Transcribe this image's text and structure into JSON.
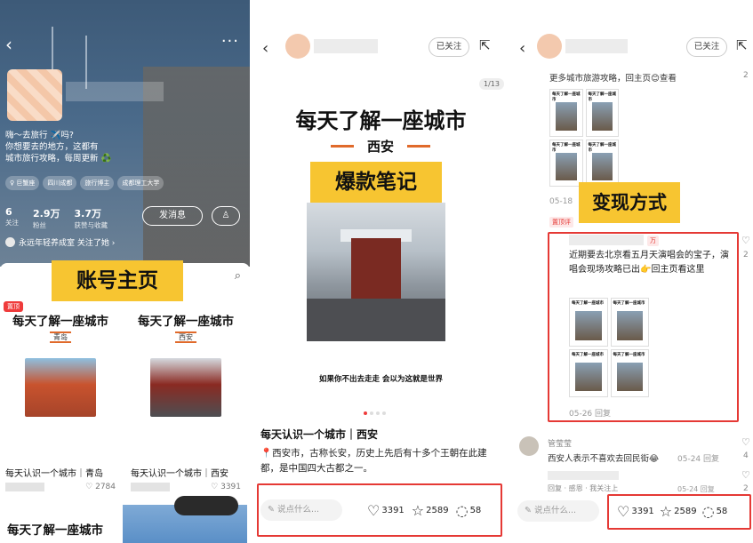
{
  "panel1": {
    "overlay_label": "账号主页",
    "bio": [
      "嗨～去旅行 ✈️吗?",
      "你想要去的地方，这都有",
      "城市旅行攻略，每周更新 ♻️"
    ],
    "tags": [
      "♀ 巨蟹座",
      "四川成都",
      "旅行博主",
      "成都理工大学"
    ],
    "stats": [
      {
        "value": "6",
        "label": "关注"
      },
      {
        "value": "2.9万",
        "label": "粉丝"
      },
      {
        "value": "3.7万",
        "label": "获赞与收藏"
      }
    ],
    "message_button": "发消息",
    "followed_by": "永远年轻养成室 关注了她 ›",
    "pin_badge": "置顶",
    "cards": [
      {
        "title": "每天了解一座城市",
        "city": "青岛",
        "name": "每天认识一个城市｜青岛",
        "likes": "2784"
      },
      {
        "title": "每天了解一座城市",
        "city": "西安",
        "name": "每天认识一个城市｜西安",
        "likes": "3391"
      }
    ],
    "bottom_title": "每天了解一座城市"
  },
  "panel2": {
    "follow_label": "已关注",
    "page_indicator": "1/13",
    "title": "每天了解一座城市",
    "city": "西安",
    "overlay_label": "爆款笔记",
    "quote": "如果你不出去走走 会以为这就是世界",
    "note_title": "每天认识一个城市｜西安",
    "description": "📍西安市，古称长安，历史上先后有十多个王朝在此建都，是中国四大古都之一。",
    "comment_placeholder": "说点什么...",
    "likes": "3391",
    "collects": "2589",
    "comments": "58"
  },
  "panel3": {
    "follow_label": "已关注",
    "top_comment": "更多城市旅游攻略，回主页😊查看",
    "top_comment_count": "2",
    "thumb_title": "每天了解一座城市",
    "date1": "05-18",
    "overlay_label": "变现方式",
    "pin_tag": "置顶评",
    "author_tag": "万",
    "main_comment": "近期要去北京看五月天演唱会的宝子，演唱会现场攻略已出👉回主页看这里",
    "main_comment_count": "2",
    "date2": "05-26 回复",
    "commenter_name": "管莹莹",
    "commenter_text": "西安人表示不喜欢去回民街😂",
    "commenter_date": "05-24 回复",
    "commenter_count": "4",
    "tail_text": "回复 · 感恩 · 我关注上",
    "tail_date": "05-24 回复",
    "tail_count": "2",
    "comment_placeholder": "说点什么...",
    "likes": "3391",
    "collects": "2589",
    "comments": "58"
  },
  "colors": {
    "overlay_yellow": "#f7c531",
    "highlight_red": "#e53935",
    "accent_orange": "#e06a2b"
  }
}
